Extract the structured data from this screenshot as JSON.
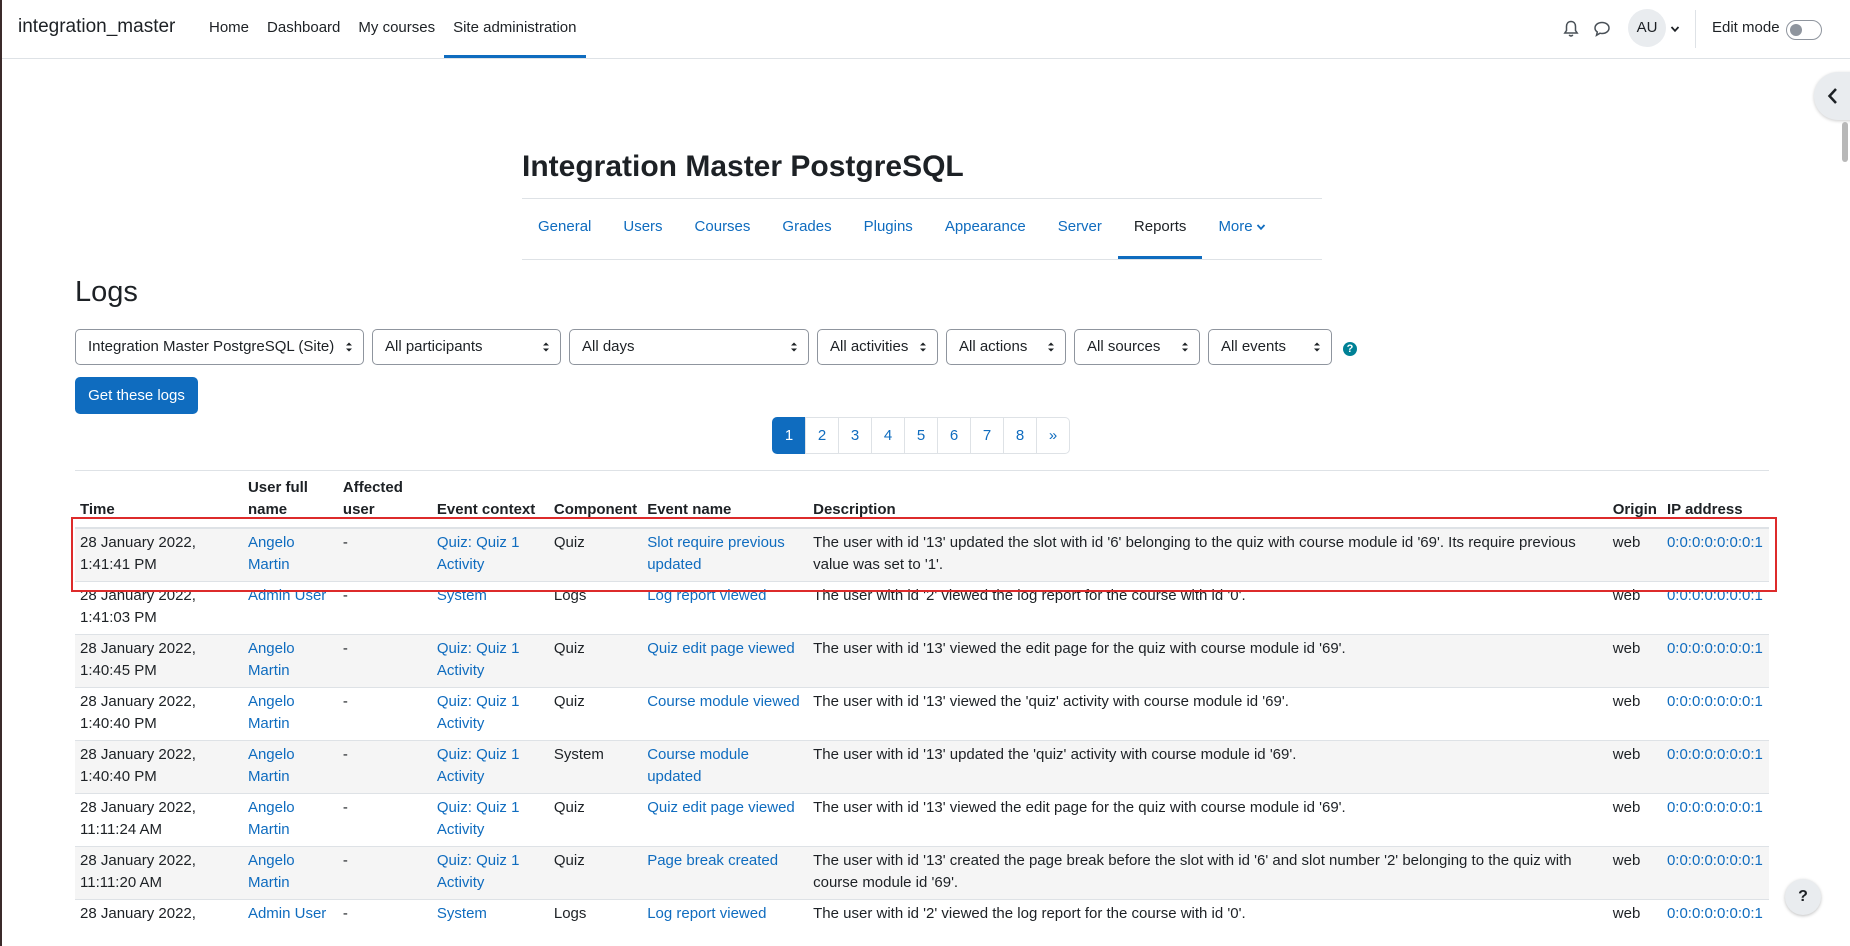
{
  "navbar": {
    "brand": "integration_master",
    "items": [
      {
        "label": "Home"
      },
      {
        "label": "Dashboard"
      },
      {
        "label": "My courses"
      },
      {
        "label": "Site administration"
      }
    ],
    "avatar_initials": "AU",
    "edit_mode_label": "Edit mode"
  },
  "page": {
    "site_title": "Integration Master PostgreSQL",
    "tabs": [
      {
        "label": "General"
      },
      {
        "label": "Users"
      },
      {
        "label": "Courses"
      },
      {
        "label": "Grades"
      },
      {
        "label": "Plugins"
      },
      {
        "label": "Appearance"
      },
      {
        "label": "Server"
      },
      {
        "label": "Reports"
      },
      {
        "label": "More"
      }
    ],
    "heading": "Logs"
  },
  "filters": {
    "course": "Integration Master PostgreSQL (Site)",
    "participants": "All participants",
    "days": "All days",
    "activities": "All activities",
    "actions": "All actions",
    "sources": "All sources",
    "events": "All events",
    "help_glyph": "?",
    "submit_label": "Get these logs"
  },
  "pagination": [
    "1",
    "2",
    "3",
    "4",
    "5",
    "6",
    "7",
    "8",
    "»"
  ],
  "table": {
    "headers": {
      "time": "Time",
      "user_full_name": "User full name",
      "affected_user": "Affected user",
      "event_context": "Event context",
      "component": "Component",
      "event_name": "Event name",
      "description": "Description",
      "origin": "Origin",
      "ip_address": "IP address"
    },
    "rows": [
      {
        "time": "28 January 2022, 1:41:41 PM",
        "user": "Angelo Martin",
        "affected": "-",
        "context": "Quiz: Quiz 1 Activity",
        "component": "Quiz",
        "event": "Slot require previous updated",
        "description": "The user with id '13' updated the slot with id '6' belonging to the quiz with course module id '69'. Its require previous value was set to '1'.",
        "origin": "web",
        "ip": "0:0:0:0:0:0:0:1"
      },
      {
        "time": "28 January 2022, 1:41:03 PM",
        "user": "Admin User",
        "affected": "-",
        "context": "System",
        "component": "Logs",
        "event": "Log report viewed",
        "description": "The user with id '2' viewed the log report for the course with id '0'.",
        "origin": "web",
        "ip": "0:0:0:0:0:0:0:1"
      },
      {
        "time": "28 January 2022, 1:40:45 PM",
        "user": "Angelo Martin",
        "affected": "-",
        "context": "Quiz: Quiz 1 Activity",
        "component": "Quiz",
        "event": "Quiz edit page viewed",
        "description": "The user with id '13' viewed the edit page for the quiz with course module id '69'.",
        "origin": "web",
        "ip": "0:0:0:0:0:0:0:1"
      },
      {
        "time": "28 January 2022, 1:40:40 PM",
        "user": "Angelo Martin",
        "affected": "-",
        "context": "Quiz: Quiz 1 Activity",
        "component": "Quiz",
        "event": "Course module viewed",
        "description": "The user with id '13' viewed the 'quiz' activity with course module id '69'.",
        "origin": "web",
        "ip": "0:0:0:0:0:0:0:1"
      },
      {
        "time": "28 January 2022, 1:40:40 PM",
        "user": "Angelo Martin",
        "affected": "-",
        "context": "Quiz: Quiz 1 Activity",
        "component": "System",
        "event": "Course module updated",
        "description": "The user with id '13' updated the 'quiz' activity with course module id '69'.",
        "origin": "web",
        "ip": "0:0:0:0:0:0:0:1"
      },
      {
        "time": "28 January 2022, 11:11:24 AM",
        "user": "Angelo Martin",
        "affected": "-",
        "context": "Quiz: Quiz 1 Activity",
        "component": "Quiz",
        "event": "Quiz edit page viewed",
        "description": "The user with id '13' viewed the edit page for the quiz with course module id '69'.",
        "origin": "web",
        "ip": "0:0:0:0:0:0:0:1"
      },
      {
        "time": "28 January 2022, 11:11:20 AM",
        "user": "Angelo Martin",
        "affected": "-",
        "context": "Quiz: Quiz 1 Activity",
        "component": "Quiz",
        "event": "Page break created",
        "description": "The user with id '13' created the page break before the slot with id '6' and slot number '2' belonging to the quiz with course module id '69'.",
        "origin": "web",
        "ip": "0:0:0:0:0:0:0:1"
      },
      {
        "time": "28 January 2022,",
        "user": "Admin User",
        "affected": "-",
        "context": "System",
        "component": "Logs",
        "event": "Log report viewed",
        "description": "The user with id '2' viewed the log report for the course with id '0'.",
        "origin": "web",
        "ip": "0:0:0:0:0:0:0:1"
      }
    ]
  },
  "help_button": "?",
  "icons": {
    "notifications": "bell-icon",
    "messages": "chat-icon",
    "drawer": "chevron-left-icon"
  },
  "colors": {
    "accent": "#0f6cbf",
    "highlight": "#dd2b2b",
    "help": "#008196"
  }
}
